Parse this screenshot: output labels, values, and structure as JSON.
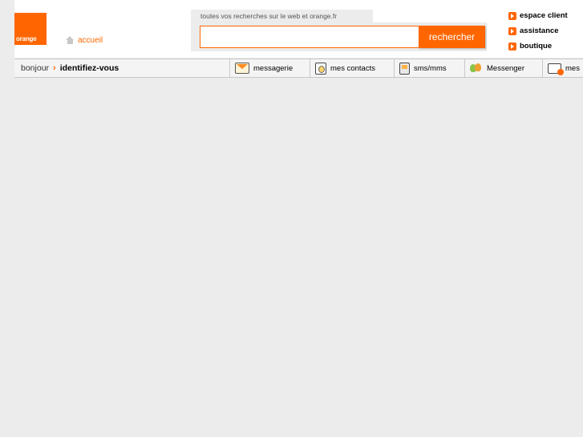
{
  "header": {
    "logo_text": "orange",
    "home_label": "accueil",
    "search": {
      "tab_label": "toutes vos recherches sur le web et orange.fr",
      "value": "",
      "placeholder": "",
      "button_label": "rechercher"
    },
    "top_links": [
      "espace client",
      "assistance",
      "boutique"
    ]
  },
  "navbar": {
    "greeting": "bonjour",
    "login_label": "identifiez-vous",
    "items": [
      {
        "label": "messagerie",
        "icon": "mail-icon"
      },
      {
        "label": "mes contacts",
        "icon": "contacts-icon"
      },
      {
        "label": "sms/mms",
        "icon": "sms-icon"
      },
      {
        "label": "Messenger",
        "icon": "messenger-icon"
      },
      {
        "label": "mes",
        "icon": "mes-icon"
      }
    ]
  },
  "colors": {
    "brand_orange": "#ff6600",
    "background": "#ececec"
  }
}
